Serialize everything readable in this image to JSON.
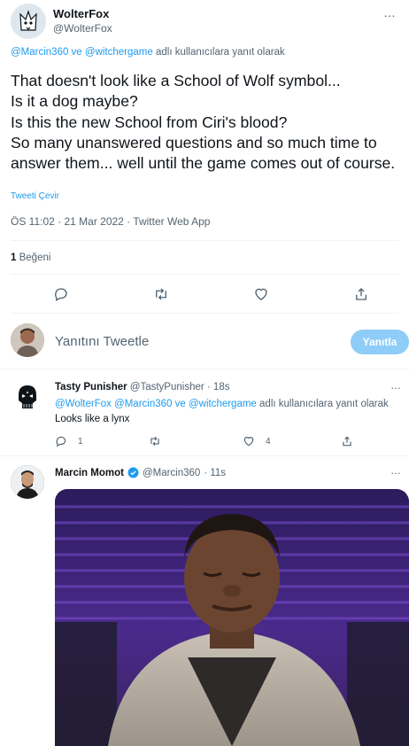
{
  "tweet": {
    "author_name": "WolterFox",
    "author_handle": "@WolterFox",
    "reply_to_users": "@Marcin360 ve @witchergame",
    "reply_to_suffix": " adlı kullanıcılara yanıt olarak",
    "text": "That doesn't look like a School of Wolf symbol...\nIs it a dog maybe?\nIs this the new School from Ciri's blood?\nSo many unanswered questions and so much time to answer them... well until the game comes out of course.",
    "translate_label": "Tweeti Çevir",
    "timestamp": "ÖS 11:02 · 21 Mar 2022 · Twitter Web App",
    "likes_count": "1",
    "likes_label": "Beğeni",
    "more_icon": "…"
  },
  "composer": {
    "placeholder": "Yanıtını Tweetle",
    "button_label": "Yanıtla",
    "button_color": "#8ecdf7"
  },
  "replies": [
    {
      "name": "Tasty Punisher",
      "handle": "@TastyPunisher",
      "time": " · 18s",
      "reply_users": "@WolterFox @Marcin360 ve @witchergame",
      "reply_suffix": " adlı kullanıcılara yanıt olarak",
      "text": "Looks like a lynx",
      "reply_count": "1",
      "like_count": "4"
    },
    {
      "name": "Marcin Momot",
      "handle": "@Marcin360",
      "time": " · 11s",
      "verified": true
    }
  ],
  "colors": {
    "accent": "#1d9bf0",
    "muted": "#536471",
    "text": "#0f1419"
  }
}
